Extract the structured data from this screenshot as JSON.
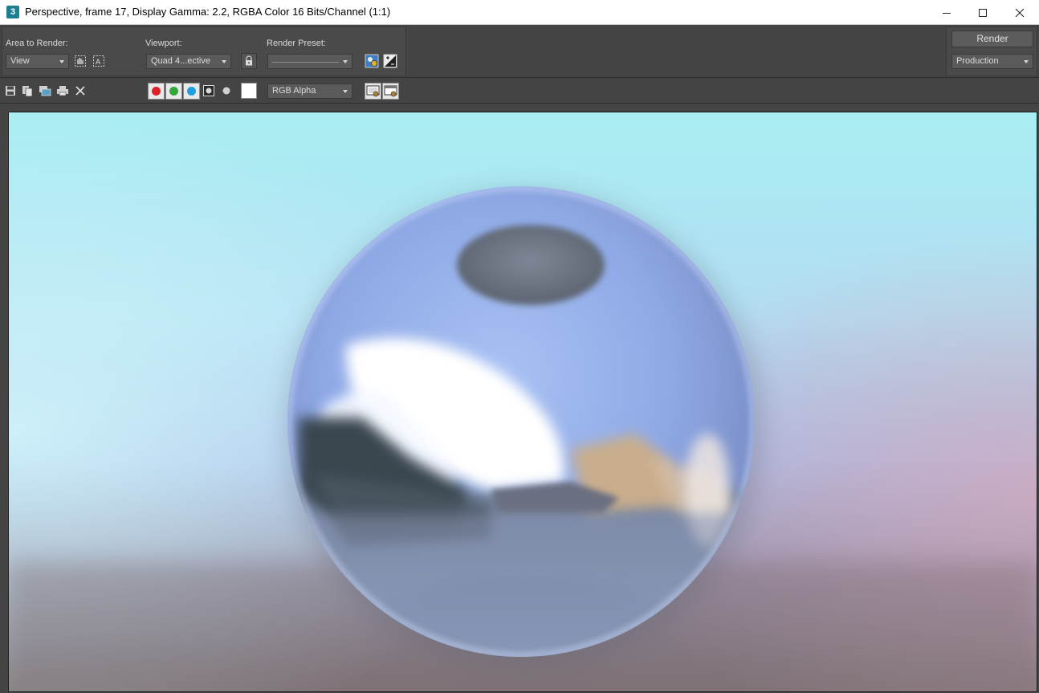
{
  "window": {
    "app_icon_label": "3",
    "title": "Perspective, frame 17, Display Gamma: 2.2, RGBA Color 16 Bits/Channel (1:1)"
  },
  "settings": {
    "area_to_render_label": "Area to Render:",
    "area_to_render_value": "View",
    "viewport_label": "Viewport:",
    "viewport_value": "Quad 4...ective",
    "render_preset_label": "Render Preset:",
    "render_preset_value": "",
    "render_button": "Render",
    "render_mode_value": "Production"
  },
  "toolbar": {
    "channel_value": "RGB Alpha",
    "colors": {
      "red": "#e0202a",
      "green": "#32a83c",
      "blue": "#1ea0e0"
    }
  },
  "icons": [
    "save-image-icon",
    "copy-image-icon",
    "clone-window-icon",
    "print-icon",
    "clear-icon",
    "pan-region-icon",
    "auto-region-icon",
    "lock-icon",
    "environment-icon",
    "exposure-control-icon",
    "display-channel-icon",
    "frame-buffer-icon",
    "render-history-icon"
  ]
}
